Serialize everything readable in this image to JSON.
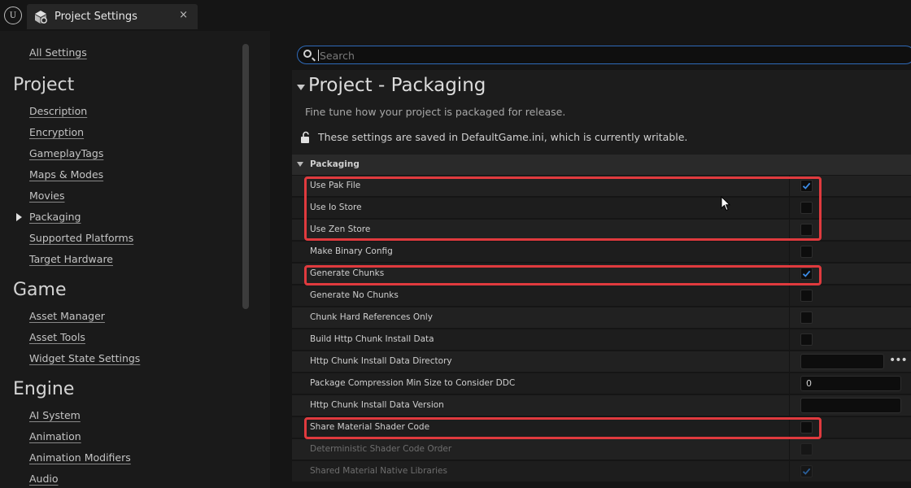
{
  "window": {
    "tab_title": "Project Settings",
    "close_glyph": "×"
  },
  "sidebar": {
    "all_settings": "All Settings",
    "sections": [
      {
        "title": "Project",
        "items": [
          "Description",
          "Encryption",
          "GameplayTags",
          "Maps & Modes",
          "Movies",
          "Packaging",
          "Supported Platforms",
          "Target Hardware"
        ]
      },
      {
        "title": "Game",
        "items": [
          "Asset Manager",
          "Asset Tools",
          "Widget State Settings"
        ]
      },
      {
        "title": "Engine",
        "items": [
          "AI System",
          "Animation",
          "Animation Modifiers",
          "Audio"
        ]
      }
    ],
    "selected_item": "Packaging"
  },
  "search": {
    "placeholder": "Search",
    "value": ""
  },
  "page": {
    "title": "Project - Packaging",
    "description": "Fine tune how your project is packaged for release.",
    "writable_note": "These settings are saved in DefaultGame.ini, which is currently writable."
  },
  "category": {
    "label": "Packaging"
  },
  "rows": [
    {
      "label": "Use Pak File",
      "type": "checkbox",
      "checked": true
    },
    {
      "label": "Use Io Store",
      "type": "checkbox",
      "checked": false
    },
    {
      "label": "Use Zen Store",
      "type": "checkbox",
      "checked": false
    },
    {
      "label": "Make Binary Config",
      "type": "checkbox",
      "checked": false
    },
    {
      "label": "Generate Chunks",
      "type": "checkbox",
      "checked": true
    },
    {
      "label": "Generate No Chunks",
      "type": "checkbox",
      "checked": false
    },
    {
      "label": "Chunk Hard References Only",
      "type": "checkbox",
      "checked": false
    },
    {
      "label": "Build Http Chunk Install Data",
      "type": "checkbox",
      "checked": false
    },
    {
      "label": "Http Chunk Install Data Directory",
      "type": "path",
      "value": "",
      "browse": "•••"
    },
    {
      "label": "Package Compression Min Size to Consider DDC",
      "type": "number",
      "value": "0"
    },
    {
      "label": "Http Chunk Install Data Version",
      "type": "text",
      "value": ""
    },
    {
      "label": "Share Material Shader Code",
      "type": "checkbox",
      "checked": false
    },
    {
      "label": "Deterministic Shader Code Order",
      "type": "checkbox",
      "checked": false,
      "disabled": true
    },
    {
      "label": "Shared Material Native Libraries",
      "type": "checkbox",
      "checked": true,
      "disabled": true
    }
  ],
  "colors": {
    "accent": "#2f6ab8",
    "highlight": "#e03a3e",
    "check": "#3c8ce7"
  }
}
